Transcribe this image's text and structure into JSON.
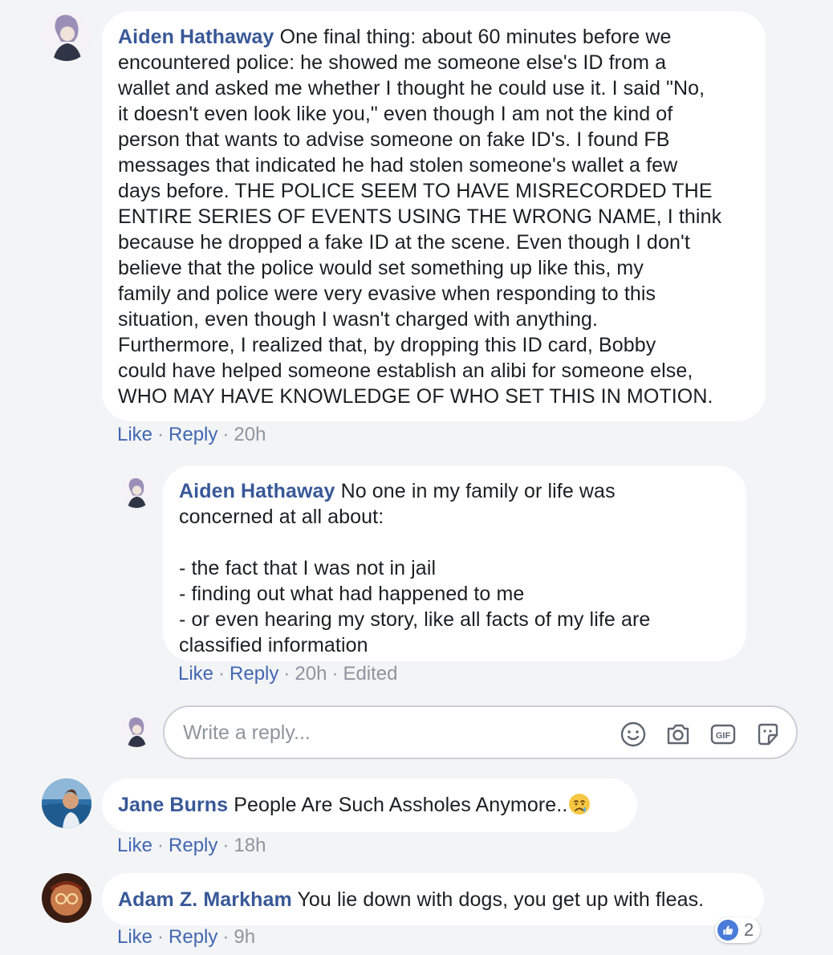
{
  "comments": [
    {
      "author": "Aiden Hathaway",
      "text": "One final thing: about 60 minutes before we\nencountered police: he showed me someone else's ID from a\nwallet and asked me whether I thought he could use it. I said \"No,\nit doesn't even look like you,\" even though I am not the kind of\nperson that wants to advise someone on fake ID's. I found FB\nmessages that indicated he had stolen someone's wallet a few\ndays before. THE POLICE SEEM TO HAVE MISRECORDED THE\nENTIRE SERIES OF EVENTS USING THE WRONG NAME, I think\nbecause he dropped a fake ID at the scene. Even though I don't\nbelieve that the police would set something up like this, my\nfamily and police were very evasive when responding to this\nsituation, even though I wasn't charged with anything.\nFurthermore, I realized that, by dropping this ID card, Bobby\ncould have helped someone establish an alibi for someone else,\nWHO MAY HAVE KNOWLEDGE OF WHO SET THIS IN MOTION.",
      "like_label": "Like",
      "reply_label": "Reply",
      "time": "20h"
    },
    {
      "author": "Aiden Hathaway",
      "text": "No one in my family or life was\nconcerned at all about:\n\n- the fact that I was not in jail\n- finding out what had happened to me\n- or even hearing my story, like all facts of my life are\nclassified information",
      "like_label": "Like",
      "reply_label": "Reply",
      "time": "20h",
      "edited": "Edited"
    },
    {
      "author": "Jane Burns",
      "text": "People Are Such Assholes Anymore..",
      "emoji": "crying-face",
      "like_label": "Like",
      "reply_label": "Reply",
      "time": "18h"
    },
    {
      "author": "Adam Z. Markham",
      "text": "You lie down with dogs, you get up with fleas.",
      "like_label": "Like",
      "reply_label": "Reply",
      "time": "9h",
      "reaction_count": "2"
    }
  ],
  "reply_box": {
    "placeholder": "Write a reply...",
    "tools": [
      "emoji-icon",
      "camera-icon",
      "gif-icon",
      "sticker-icon"
    ],
    "gif_label": "GIF"
  },
  "colors": {
    "author": "#385898",
    "action": "#4267b2",
    "meta": "#90949c",
    "background": "#f3f4f6"
  }
}
